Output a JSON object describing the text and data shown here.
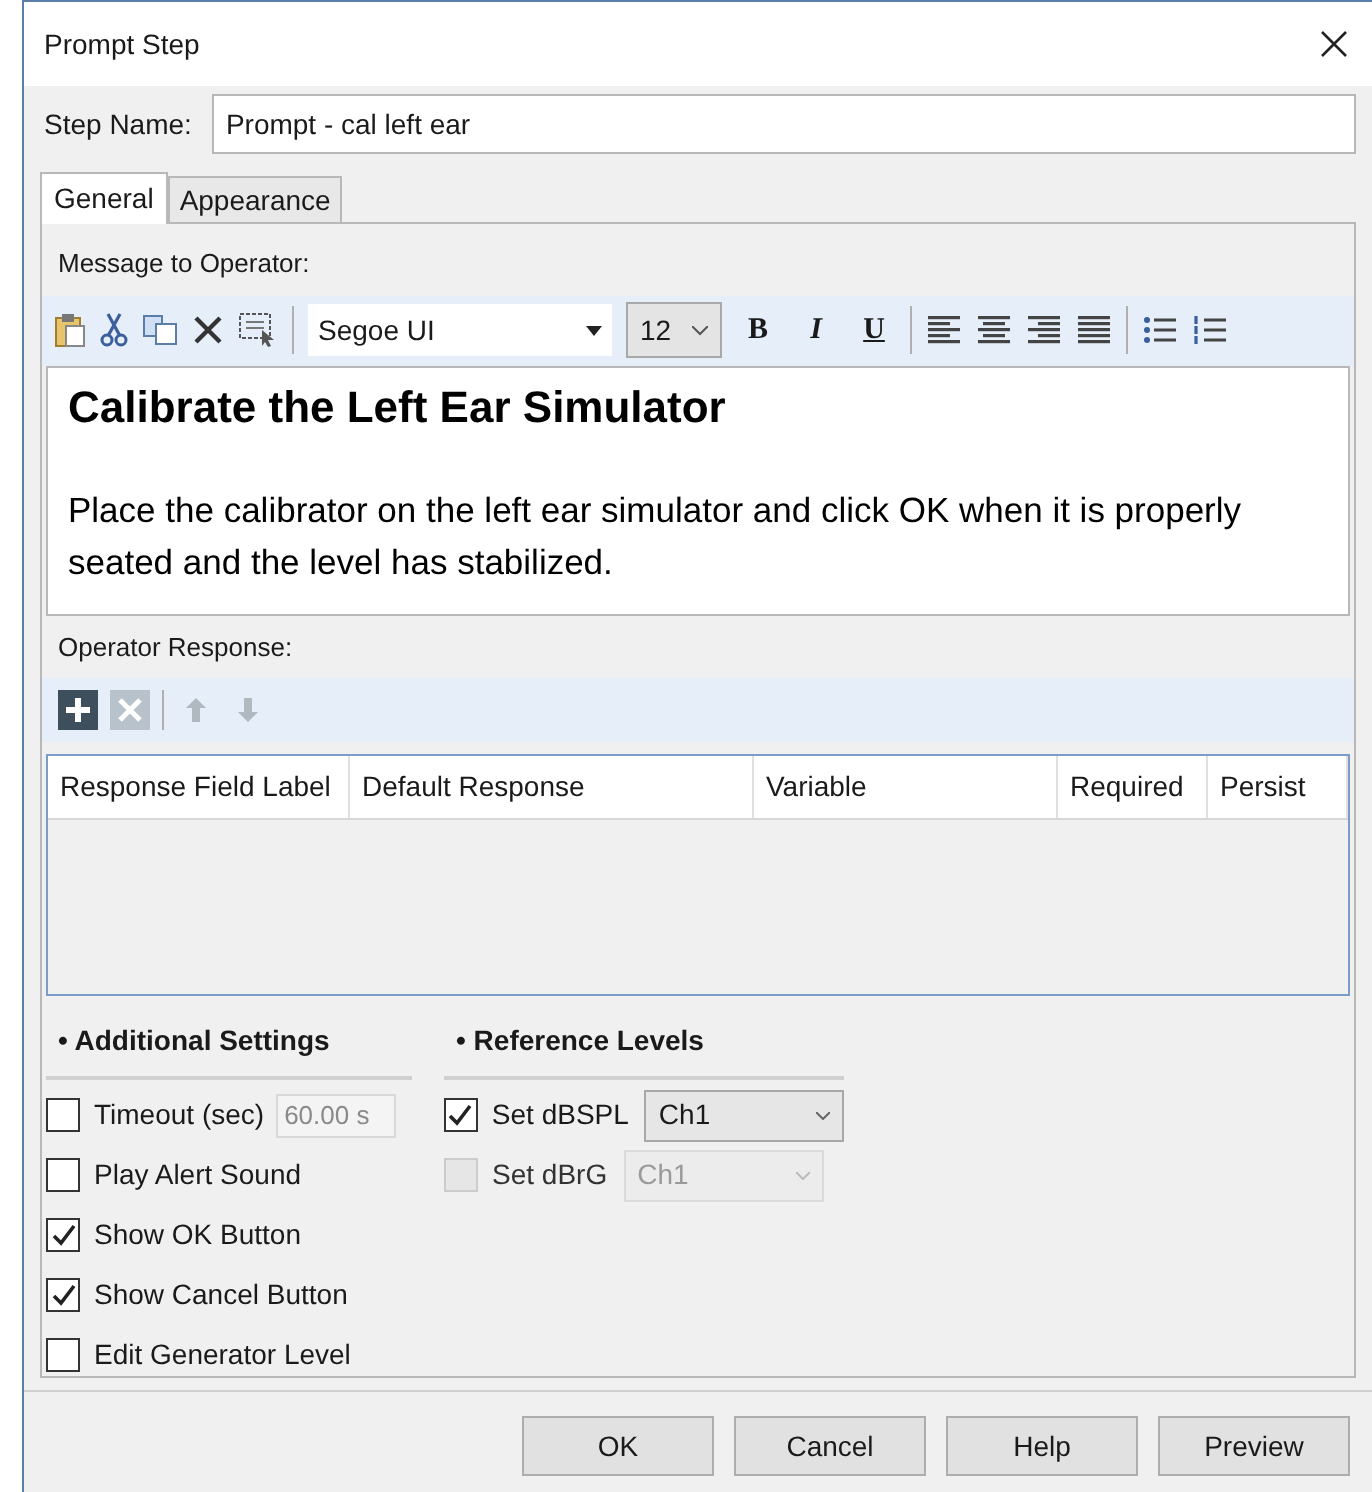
{
  "window": {
    "title": "Prompt Step"
  },
  "step_name": {
    "label": "Step Name:",
    "value": "Prompt - cal left ear"
  },
  "tabs": [
    {
      "label": "General",
      "selected": true
    },
    {
      "label": "Appearance",
      "selected": false
    }
  ],
  "message": {
    "label": "Message to Operator:",
    "font": "Segoe UI",
    "size": "12",
    "format_buttons": [
      "B",
      "I",
      "U"
    ],
    "heading": "Calibrate the Left Ear Simulator",
    "body": "Place the calibrator on the left ear simulator and click OK when it is properly seated and the level has stabilized."
  },
  "response": {
    "label": "Operator Response:",
    "columns": [
      "Response Field Label",
      "Default Response",
      "Variable",
      "Required",
      "Persist"
    ]
  },
  "additional_settings": {
    "title": "• Additional Settings",
    "items": [
      {
        "label": "Timeout (sec)",
        "checked": false,
        "field": {
          "value": "60.00 s",
          "disabled": true
        }
      },
      {
        "label": "Play Alert Sound",
        "checked": false
      },
      {
        "label": "Show OK Button",
        "checked": true
      },
      {
        "label": "Show Cancel Button",
        "checked": true
      },
      {
        "label": "Edit Generator Level",
        "checked": false
      }
    ]
  },
  "reference_levels": {
    "title": "• Reference Levels",
    "items": [
      {
        "label": "Set dBSPL",
        "checked": true,
        "disabled": false,
        "channel": "Ch1"
      },
      {
        "label": "Set dBrG",
        "checked": false,
        "disabled": true,
        "channel": "Ch1"
      }
    ]
  },
  "buttons": [
    "OK",
    "Cancel",
    "Help",
    "Preview"
  ]
}
